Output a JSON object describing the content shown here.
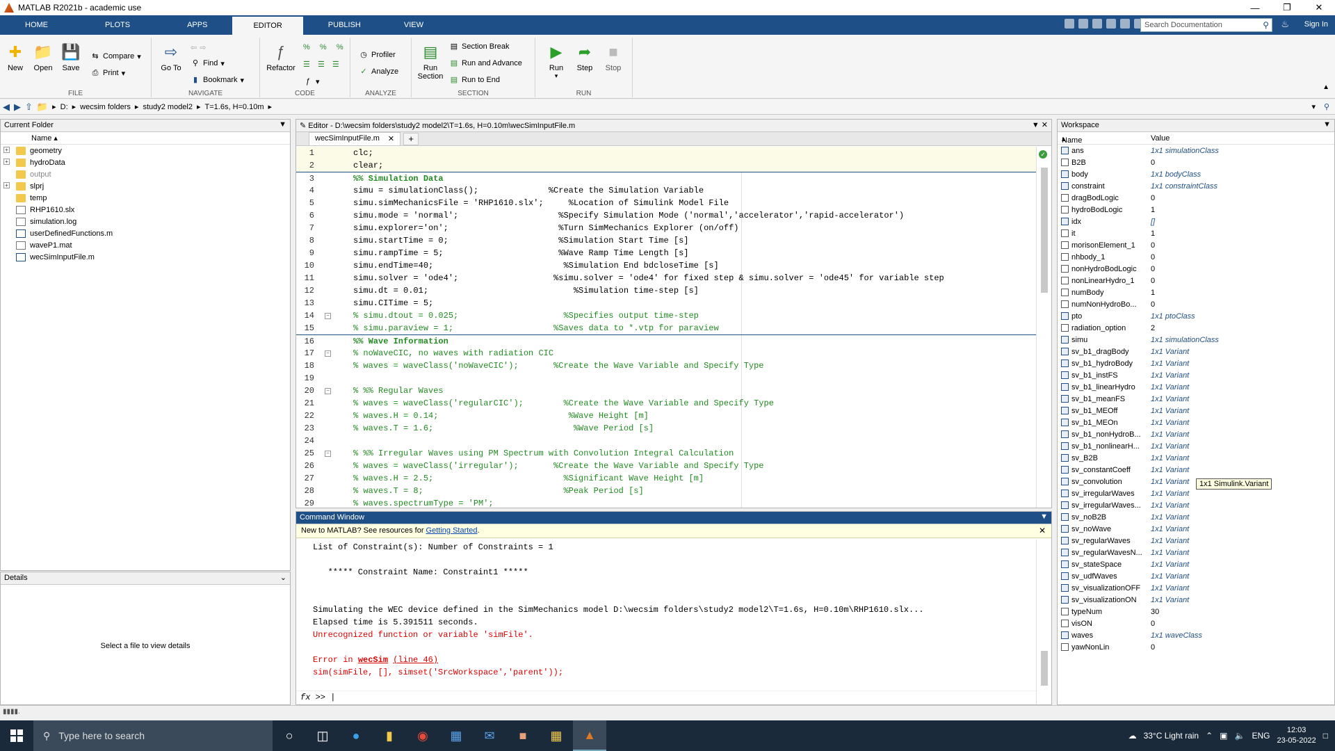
{
  "window": {
    "title": "MATLAB R2021b - academic use"
  },
  "tabs": [
    {
      "label": "HOME"
    },
    {
      "label": "PLOTS"
    },
    {
      "label": "APPS"
    },
    {
      "label": "EDITOR"
    },
    {
      "label": "PUBLISH"
    },
    {
      "label": "VIEW"
    }
  ],
  "search": {
    "placeholder": "Search Documentation"
  },
  "signin": "Sign In",
  "ribbon": {
    "file": {
      "label": "FILE",
      "new": "New",
      "open": "Open",
      "save": "Save",
      "compare": "Compare",
      "print": "Print"
    },
    "navigate": {
      "label": "NAVIGATE",
      "goto": "Go To",
      "find": "Find",
      "bookmark": "Bookmark"
    },
    "code": {
      "label": "CODE",
      "refactor": "Refactor"
    },
    "analyze": {
      "label": "ANALYZE",
      "profiler": "Profiler",
      "analyze": "Analyze"
    },
    "section": {
      "label": "SECTION",
      "run_section": "Run Section",
      "section_break": "Section Break",
      "run_advance": "Run and Advance",
      "run_end": "Run to End"
    },
    "run": {
      "label": "RUN",
      "run": "Run",
      "step": "Step",
      "stop": "Stop"
    }
  },
  "path": [
    "D:",
    "wecsim folders",
    "study2 model2",
    "T=1.6s, H=0.10m"
  ],
  "current_folder": {
    "title": "Current Folder",
    "col": "Name",
    "items": [
      {
        "name": "geometry",
        "type": "folder",
        "expandable": true
      },
      {
        "name": "hydroData",
        "type": "folder",
        "expandable": true
      },
      {
        "name": "output",
        "type": "folder",
        "expandable": false,
        "grey": true
      },
      {
        "name": "slprj",
        "type": "folder",
        "expandable": true
      },
      {
        "name": "temp",
        "type": "folder",
        "expandable": false
      },
      {
        "name": "RHP1610.slx",
        "type": "file"
      },
      {
        "name": "simulation.log",
        "type": "file"
      },
      {
        "name": "userDefinedFunctions.m",
        "type": "m"
      },
      {
        "name": "waveP1.mat",
        "type": "file"
      },
      {
        "name": "wecSimInputFile.m",
        "type": "m"
      }
    ]
  },
  "details": {
    "title": "Details",
    "message": "Select a file to view details"
  },
  "editor": {
    "title": "Editor - D:\\wecsim folders\\study2 model2\\T=1.6s, H=0.10m\\wecSimInputFile.m",
    "tab": "wecSimInputFile.m",
    "lines": [
      {
        "n": "1",
        "t": "clc;",
        "c": "",
        "fold": false
      },
      {
        "n": "2",
        "t": "clear;",
        "c": "",
        "fold": false
      },
      {
        "n": "3",
        "t": "%% Simulation Data",
        "c": "cm bold",
        "fold": false,
        "sec": true
      },
      {
        "n": "4",
        "t": "simu = simulationClass();              %Create the Simulation Variable",
        "c": "",
        "fold": false
      },
      {
        "n": "5",
        "t": "simu.simMechanicsFile = 'RHP1610.slx';     %Location of Simulink Model File",
        "c": "",
        "fold": false
      },
      {
        "n": "6",
        "t": "simu.mode = 'normal';                    %Specify Simulation Mode ('normal','accelerator','rapid-accelerator')",
        "c": "",
        "fold": false
      },
      {
        "n": "7",
        "t": "simu.explorer='on';                      %Turn SimMechanics Explorer (on/off)",
        "c": "",
        "fold": false
      },
      {
        "n": "8",
        "t": "simu.startTime = 0;                      %Simulation Start Time [s]",
        "c": "",
        "fold": false
      },
      {
        "n": "9",
        "t": "simu.rampTime = 5;                       %Wave Ramp Time Length [s]",
        "c": "",
        "fold": false
      },
      {
        "n": "10",
        "t": "simu.endTime=40;                          %Simulation End bdcloseTime [s]",
        "c": "",
        "fold": false
      },
      {
        "n": "11",
        "t": "simu.solver = 'ode4';                   %simu.solver = 'ode4' for fixed step & simu.solver = 'ode45' for variable step",
        "c": "",
        "fold": false
      },
      {
        "n": "12",
        "t": "simu.dt = 0.01;                             %Simulation time-step [s]",
        "c": "",
        "fold": false
      },
      {
        "n": "13",
        "t": "simu.CITime = 5;",
        "c": "",
        "fold": false
      },
      {
        "n": "14",
        "t": "% simu.dtout = 0.025;                     %Specifies output time-step",
        "c": "cm",
        "fold": true
      },
      {
        "n": "15",
        "t": "% simu.paraview = 1;                    %Saves data to *.vtp for paraview",
        "c": "cm",
        "fold": false
      },
      {
        "n": "16",
        "t": "%% Wave Information",
        "c": "cm bold",
        "fold": false,
        "sec": true
      },
      {
        "n": "17",
        "t": "% noWaveCIC, no waves with radiation CIC",
        "c": "cm",
        "fold": true
      },
      {
        "n": "18",
        "t": "% waves = waveClass('noWaveCIC');       %Create the Wave Variable and Specify Type",
        "c": "cm",
        "fold": false
      },
      {
        "n": "19",
        "t": "",
        "c": "",
        "fold": false
      },
      {
        "n": "20",
        "t": "% %% Regular Waves",
        "c": "cm",
        "fold": true
      },
      {
        "n": "21",
        "t": "% waves = waveClass('regularCIC');        %Create the Wave Variable and Specify Type",
        "c": "cm",
        "fold": false
      },
      {
        "n": "22",
        "t": "% waves.H = 0.14;                          %Wave Height [m]",
        "c": "cm",
        "fold": false
      },
      {
        "n": "23",
        "t": "% waves.T = 1.6;                            %Wave Period [s]",
        "c": "cm",
        "fold": false
      },
      {
        "n": "24",
        "t": "",
        "c": "",
        "fold": false
      },
      {
        "n": "25",
        "t": "% %% Irregular Waves using PM Spectrum with Convolution Integral Calculation",
        "c": "cm",
        "fold": true
      },
      {
        "n": "26",
        "t": "% waves = waveClass('irregular');       %Create the Wave Variable and Specify Type",
        "c": "cm",
        "fold": false
      },
      {
        "n": "27",
        "t": "% waves.H = 2.5;                          %Significant Wave Height [m]",
        "c": "cm",
        "fold": false
      },
      {
        "n": "28",
        "t": "% waves.T = 8;                            %Peak Period [s]",
        "c": "cm",
        "fold": false
      },
      {
        "n": "29",
        "t": "% waves.spectrumType = 'PM';",
        "c": "cm",
        "fold": false
      }
    ]
  },
  "command_window": {
    "title": "Command Window",
    "notice": "New to MATLAB? See resources for ",
    "notice_link": "Getting Started",
    "notice_end": ".",
    "lines": [
      {
        "t": "List of Constraint(s): Number of Constraints = 1",
        "err": false
      },
      {
        "t": "",
        "err": false
      },
      {
        "t": "   ***** Constraint Name: Constraint1 *****",
        "err": false
      },
      {
        "t": "",
        "err": false
      },
      {
        "t": "",
        "err": false
      },
      {
        "t": "Simulating the WEC device defined in the SimMechanics model D:\\wecsim folders\\study2 model2\\T=1.6s, H=0.10m\\RHP1610.slx...",
        "err": false
      },
      {
        "t": "Elapsed time is 5.391511 seconds.",
        "err": false
      },
      {
        "t": "Unrecognized function or variable 'simFile'.",
        "err": true
      },
      {
        "t": "",
        "err": false
      }
    ],
    "error_prefix": "Error in ",
    "error_func": "wecSim",
    "error_line": "(line 46)",
    "error_code": "sim(simFile, [], simset('SrcWorkspace','parent'));",
    "prompt": ">>"
  },
  "workspace": {
    "title": "Workspace",
    "cols": {
      "name": "Name",
      "value": "Value"
    },
    "vars": [
      {
        "name": "ans",
        "value": "1x1 simulationClass",
        "obj": true
      },
      {
        "name": "B2B",
        "value": "0",
        "obj": false
      },
      {
        "name": "body",
        "value": "1x1 bodyClass",
        "obj": true
      },
      {
        "name": "constraint",
        "value": "1x1 constraintClass",
        "obj": true
      },
      {
        "name": "dragBodLogic",
        "value": "0",
        "obj": false
      },
      {
        "name": "hydroBodLogic",
        "value": "1",
        "obj": false
      },
      {
        "name": "idx",
        "value": "[]",
        "obj": true
      },
      {
        "name": "it",
        "value": "1",
        "obj": false
      },
      {
        "name": "morisonElement_1",
        "value": "0",
        "obj": false
      },
      {
        "name": "nhbody_1",
        "value": "0",
        "obj": false
      },
      {
        "name": "nonHydroBodLogic",
        "value": "0",
        "obj": false
      },
      {
        "name": "nonLinearHydro_1",
        "value": "0",
        "obj": false
      },
      {
        "name": "numBody",
        "value": "1",
        "obj": false
      },
      {
        "name": "numNonHydroBo...",
        "value": "0",
        "obj": false
      },
      {
        "name": "pto",
        "value": "1x1 ptoClass",
        "obj": true
      },
      {
        "name": "radiation_option",
        "value": "2",
        "obj": false
      },
      {
        "name": "simu",
        "value": "1x1 simulationClass",
        "obj": true
      },
      {
        "name": "sv_b1_dragBody",
        "value": "1x1 Variant",
        "obj": true
      },
      {
        "name": "sv_b1_hydroBody",
        "value": "1x1 Variant",
        "obj": true
      },
      {
        "name": "sv_b1_instFS",
        "value": "1x1 Variant",
        "obj": true
      },
      {
        "name": "sv_b1_linearHydro",
        "value": "1x1 Variant",
        "obj": true
      },
      {
        "name": "sv_b1_meanFS",
        "value": "1x1 Variant",
        "obj": true
      },
      {
        "name": "sv_b1_MEOff",
        "value": "1x1 Variant",
        "obj": true
      },
      {
        "name": "sv_b1_MEOn",
        "value": "1x1 Variant",
        "obj": true
      },
      {
        "name": "sv_b1_nonHydroB...",
        "value": "1x1 Variant",
        "obj": true
      },
      {
        "name": "sv_b1_nonlinearH...",
        "value": "1x1 Variant",
        "obj": true
      },
      {
        "name": "sv_B2B",
        "value": "1x1 Variant",
        "obj": true
      },
      {
        "name": "sv_constantCoeff",
        "value": "1x1 Variant",
        "obj": true
      },
      {
        "name": "sv_convolution",
        "value": "1x1 Variant",
        "obj": true
      },
      {
        "name": "sv_irregularWaves",
        "value": "1x1 Variant",
        "obj": true
      },
      {
        "name": "sv_irregularWaves...",
        "value": "1x1 Variant",
        "obj": true
      },
      {
        "name": "sv_noB2B",
        "value": "1x1 Variant",
        "obj": true
      },
      {
        "name": "sv_noWave",
        "value": "1x1 Variant",
        "obj": true
      },
      {
        "name": "sv_regularWaves",
        "value": "1x1 Variant",
        "obj": true
      },
      {
        "name": "sv_regularWavesN...",
        "value": "1x1 Variant",
        "obj": true
      },
      {
        "name": "sv_stateSpace",
        "value": "1x1 Variant",
        "obj": true
      },
      {
        "name": "sv_udfWaves",
        "value": "1x1 Variant",
        "obj": true
      },
      {
        "name": "sv_visualizationOFF",
        "value": "1x1 Variant",
        "obj": true
      },
      {
        "name": "sv_visualizationON",
        "value": "1x1 Variant",
        "obj": true
      },
      {
        "name": "typeNum",
        "value": "30",
        "obj": false
      },
      {
        "name": "visON",
        "value": "0",
        "obj": false
      },
      {
        "name": "waves",
        "value": "1x1 waveClass",
        "obj": true
      },
      {
        "name": "yawNonLin",
        "value": "0",
        "obj": false
      }
    ],
    "tooltip": "1x1 Simulink.Variant"
  },
  "taskbar": {
    "search": "Type here to search",
    "weather": "33°C  Light rain",
    "lang": "ENG",
    "time": "12:03",
    "date": "23-05-2022"
  },
  "colors": {
    "accent": "#1e4f86",
    "comment": "#228b22",
    "string": "#a020f0",
    "error": "#e00000"
  }
}
